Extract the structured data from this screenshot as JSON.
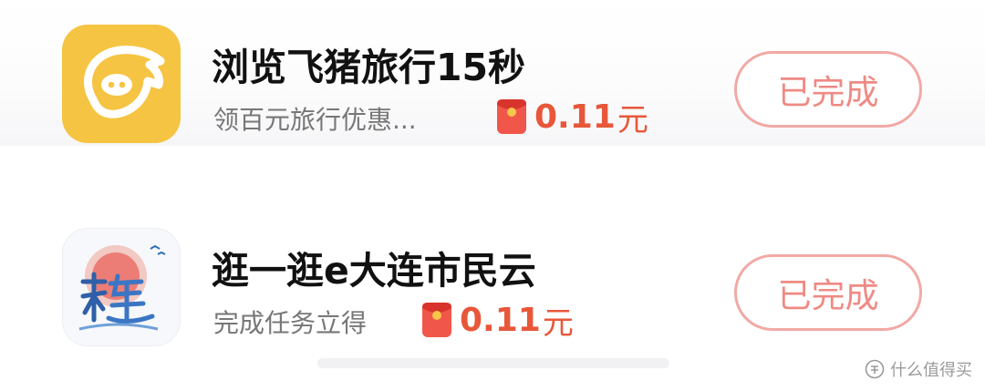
{
  "tasks": [
    {
      "app": "飞猪旅行",
      "title": "浏览飞猪旅行15秒",
      "subtitle": "领百元旅行优惠...",
      "reward_amount": "0.11",
      "reward_unit": "元",
      "status_label": "已完成",
      "icon": "fliggy-logo-icon"
    },
    {
      "app": "e大连市民云",
      "title": "逛一逛e大连市民云",
      "subtitle": "完成任务立得",
      "reward_amount": "0.11",
      "reward_unit": "元",
      "status_label": "已完成",
      "icon": "dalian-app-icon"
    }
  ],
  "watermark": {
    "text": "什么值得买"
  },
  "colors": {
    "accent": "#e8573a",
    "button_border": "#f1a9a5",
    "button_text": "#ef8a84",
    "fliggy_yellow": "#f6c443"
  }
}
